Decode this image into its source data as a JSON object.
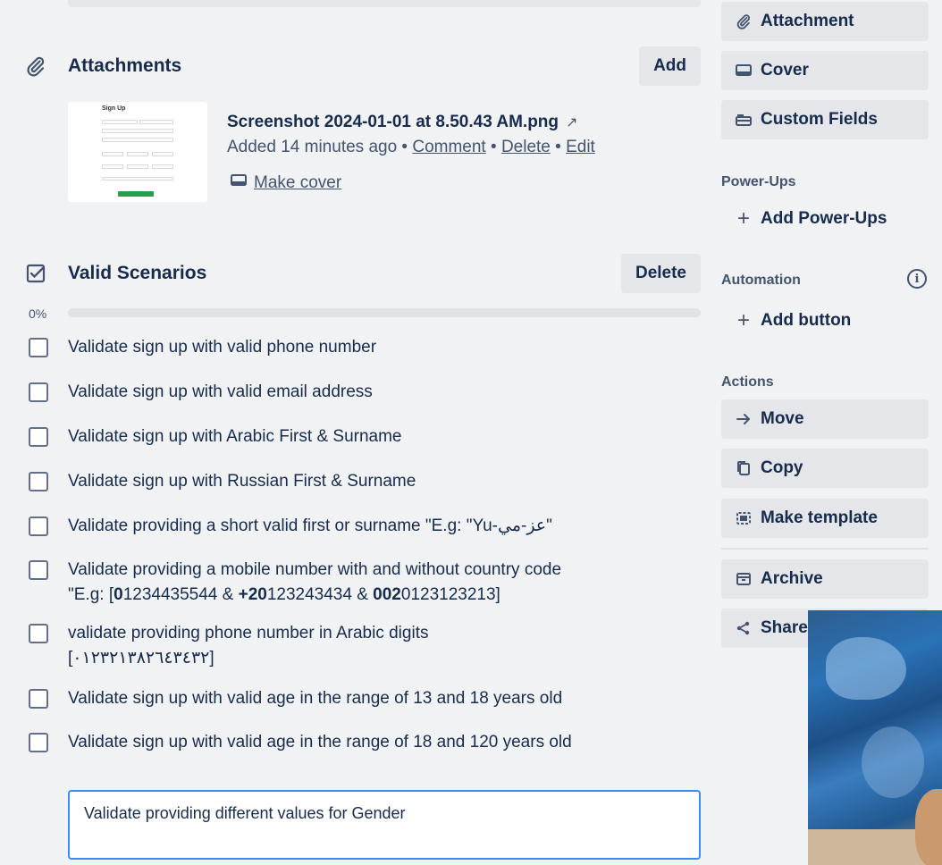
{
  "attachments": {
    "title": "Attachments",
    "add_label": "Add",
    "thumbnail": {
      "title": "Sign Up"
    },
    "file": {
      "name": "Screenshot 2024-01-01 at 8.50.43 AM.png",
      "open_glyph": "↗",
      "added": "Added 14 minutes ago",
      "sep": "•",
      "actions": [
        "Comment",
        "Delete",
        "Edit"
      ],
      "make_cover": "Make cover"
    }
  },
  "checklist": {
    "title": "Valid Scenarios",
    "delete_label": "Delete",
    "progress_text": "0%",
    "progress": 0,
    "items": [
      {
        "text": "Validate sign up with valid phone number",
        "checked": false
      },
      {
        "text": "Validate sign up with valid email address",
        "checked": false
      },
      {
        "text": "Validate sign up with Arabic First & Surname",
        "checked": false
      },
      {
        "text": "Validate sign up with Russian First & Surname",
        "checked": false
      },
      {
        "text": "Validate providing a short valid first or surname \"E.g: \"Yu-عز-مي\"",
        "checked": false
      },
      {
        "text_parts": [
          "Validate providing a mobile number with and without country code \"E.g: [",
          "0",
          "1234435544 & ",
          "+20",
          "123243434 & ",
          "002",
          "0123123213]"
        ],
        "checked": false
      },
      {
        "text": "validate providing phone number in Arabic digits [٠١٢٣٢١٣٨٢٦٤٣٤٣٢]",
        "checked": false
      },
      {
        "text": "Validate sign up with valid age in the range of 13 and 18 years old",
        "checked": false
      },
      {
        "text": "Validate sign up with valid age in the range of 18 and 120 years old",
        "checked": false
      }
    ],
    "new_item_value": "Validate providing different values for Gender"
  },
  "sidebar": {
    "top_buttons": [
      {
        "label": "Attachment",
        "icon": "paperclip-icon"
      },
      {
        "label": "Cover",
        "icon": "cover-icon"
      },
      {
        "label": "Custom Fields",
        "icon": "custom-fields-icon"
      }
    ],
    "power_ups_label": "Power-Ups",
    "add_power_ups": "Add Power-Ups",
    "automation_label": "Automation",
    "add_button": "Add button",
    "actions_label": "Actions",
    "actions": [
      {
        "label": "Move",
        "icon": "arrow-right-icon"
      },
      {
        "label": "Copy",
        "icon": "copy-icon"
      },
      {
        "label": "Make template",
        "icon": "template-icon"
      },
      {
        "label": "Archive",
        "icon": "archive-icon"
      },
      {
        "label": "Share",
        "icon": "share-icon"
      }
    ]
  }
}
